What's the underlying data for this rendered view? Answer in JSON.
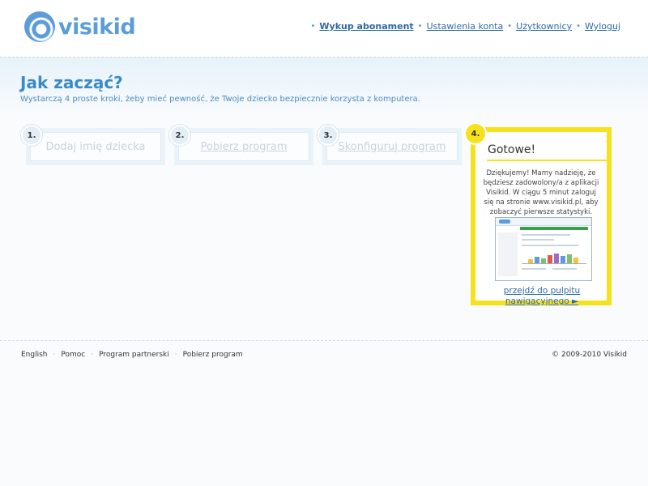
{
  "brand": {
    "name": "visikid"
  },
  "topnav": {
    "items": [
      {
        "label": "Wykup abonament"
      },
      {
        "label": "Ustawienia konta"
      },
      {
        "label": "Użytkownicy"
      },
      {
        "label": "Wyloguj"
      }
    ],
    "separator": "•"
  },
  "main": {
    "title": "Jak zacząć?",
    "subtitle": "Wystarczą 4 proste kroki, żeby mieć pewność, że Twoje dziecko bezpiecznie korzysta z komputera."
  },
  "steps": [
    {
      "number": "1.",
      "label": "Dodaj imię dziecka"
    },
    {
      "number": "2.",
      "label": "Pobierz program"
    },
    {
      "number": "3.",
      "label": "Skonfiguruj program"
    },
    {
      "number": "4.",
      "title": "Gotowe!",
      "text": "Dziękujemy! Mamy nadzieję, że będziesz zadowolony/a z aplikacji Visikid. W ciągu 5 minut zaloguj się na stronie www.visikid.pl, aby zobaczyć pierwsze statystyki.",
      "link": "przejdź do pulpitu nawigacyjnego ►"
    }
  ],
  "footer": {
    "links": [
      {
        "label": "English"
      },
      {
        "label": "Pomoc"
      },
      {
        "label": "Program partnerski"
      },
      {
        "label": "Pobierz program"
      }
    ],
    "separator": "·",
    "copyright": "© 2009-2010 Visikid"
  },
  "colors": {
    "accent": "#3a8ac8",
    "link": "#2e6aa8",
    "highlight": "#f5e21c"
  }
}
